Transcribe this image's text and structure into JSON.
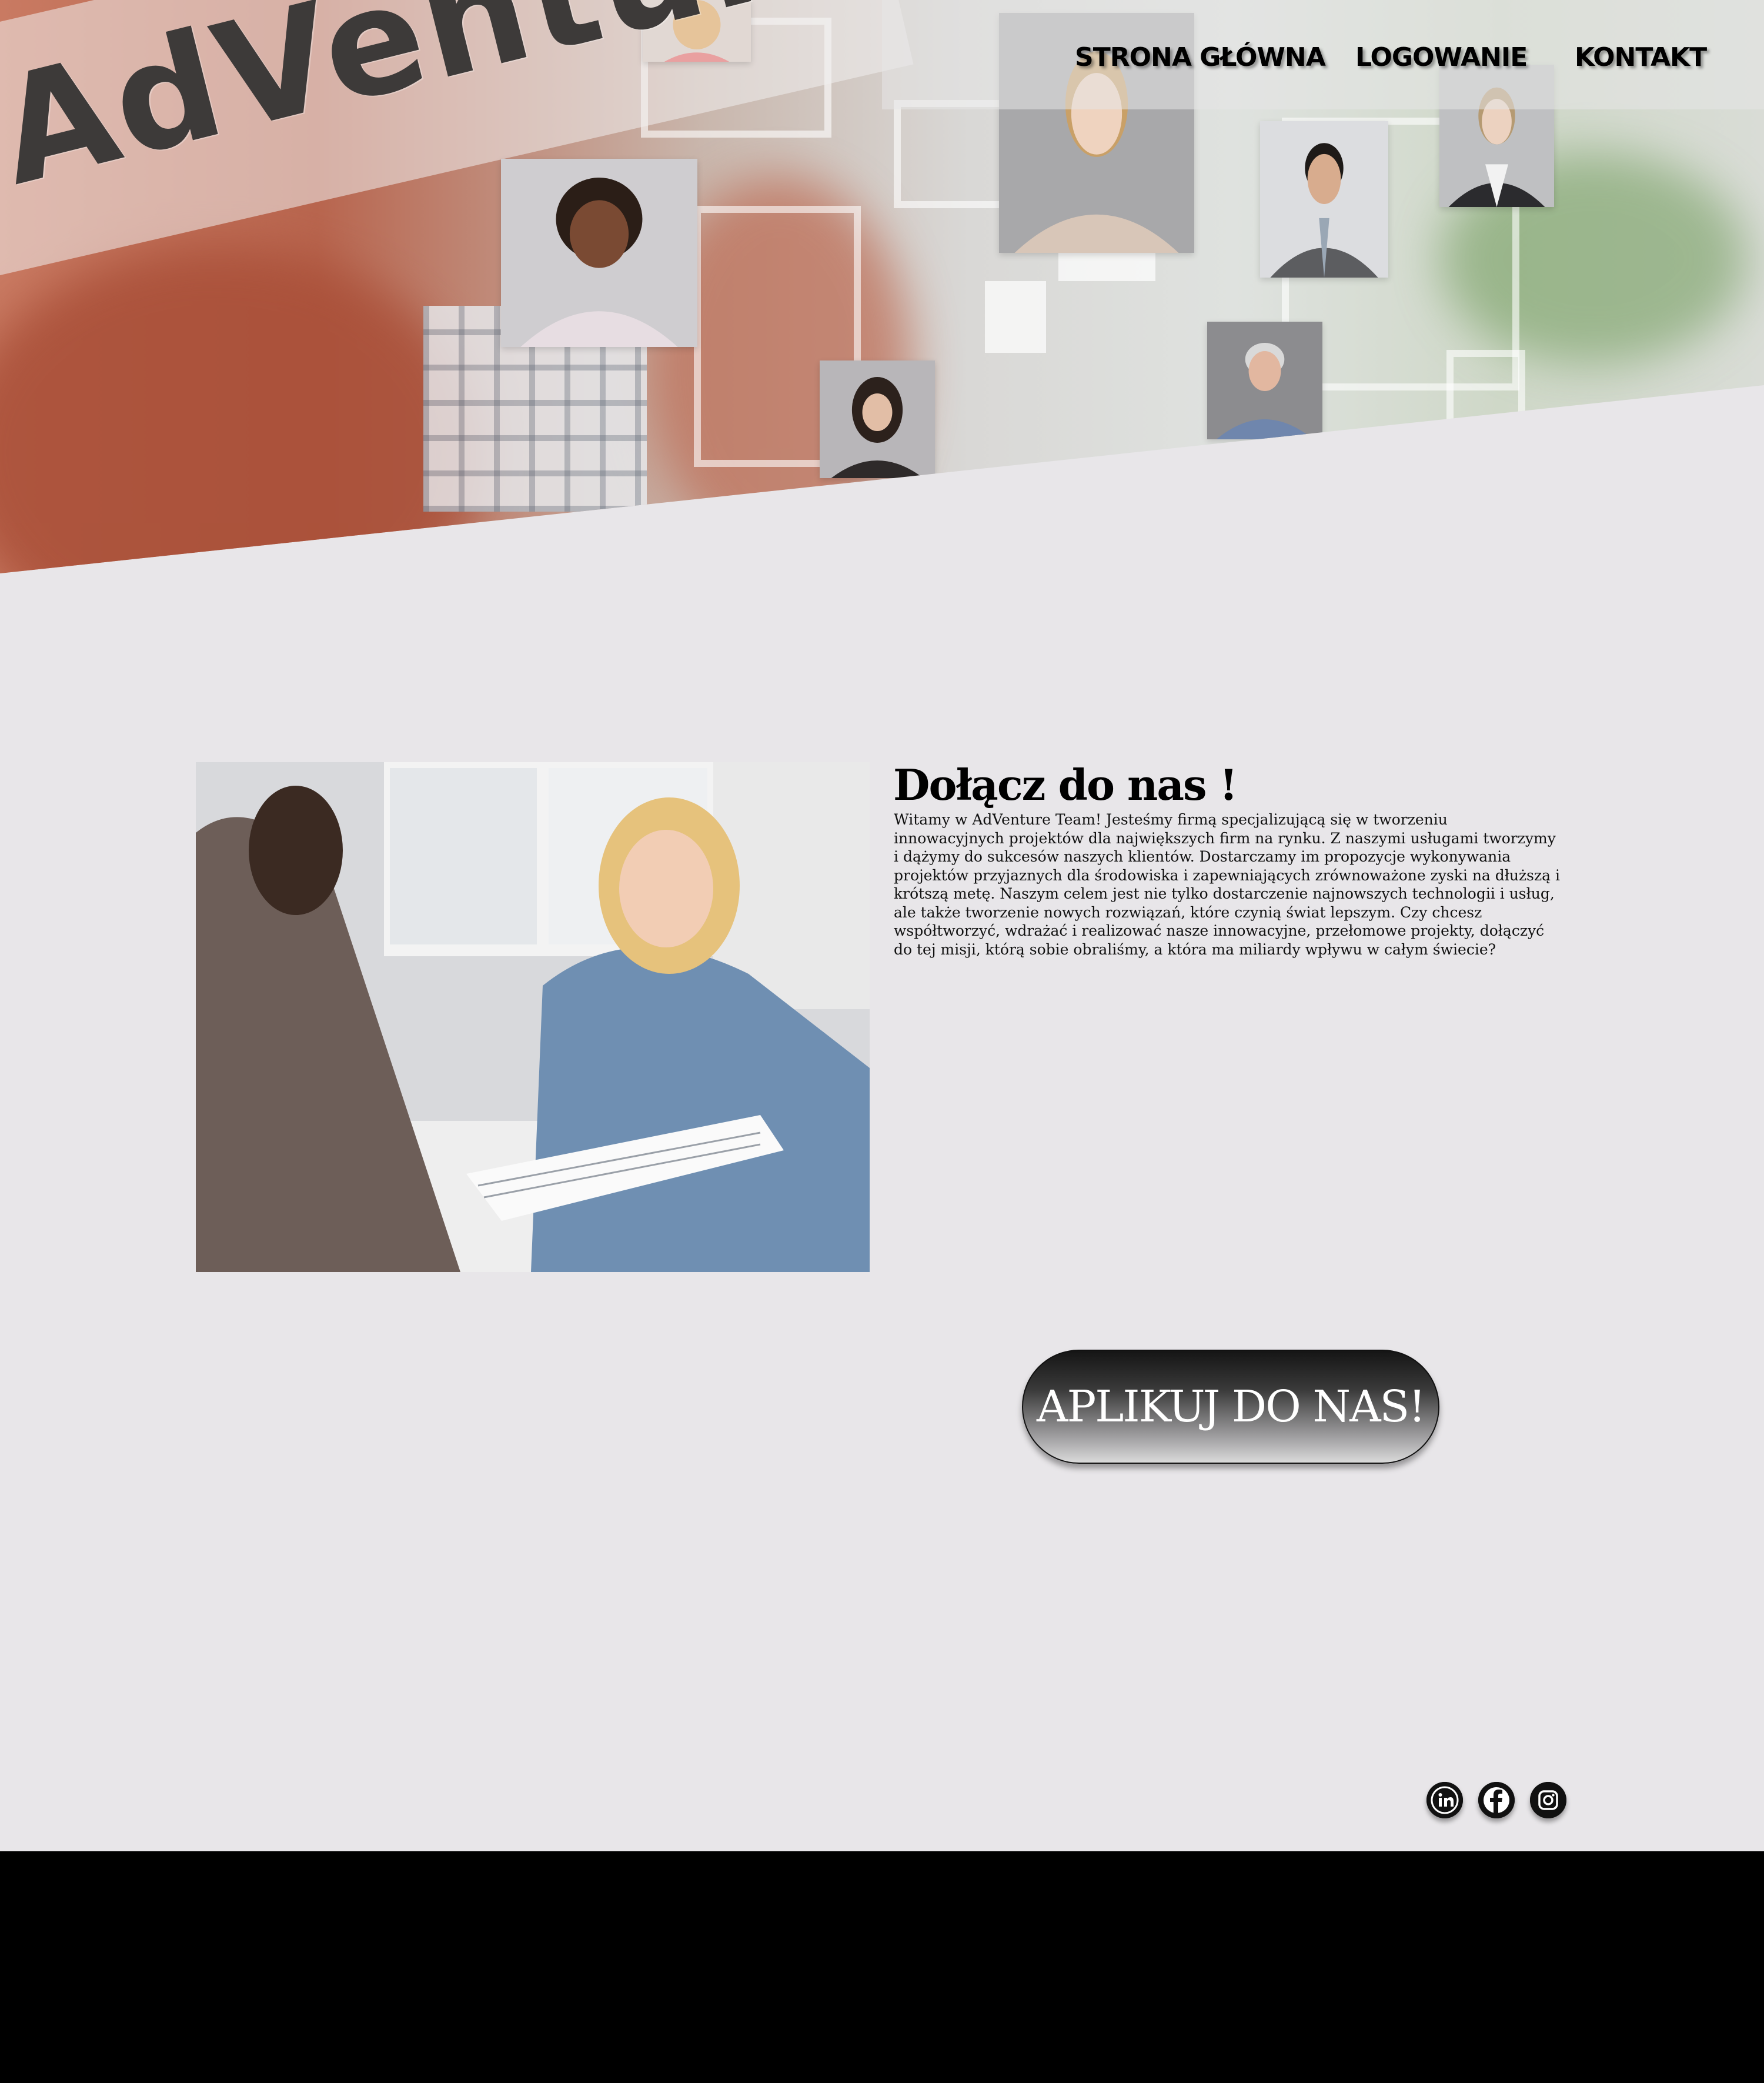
{
  "brand": {
    "logo_text": "AdVenture"
  },
  "nav": {
    "items": [
      {
        "label": "STRONA GŁÓWNA"
      },
      {
        "label": "LOGOWANIE"
      },
      {
        "label": "KONTAKT"
      }
    ]
  },
  "main": {
    "heading": "Dołącz do nas !",
    "paragraph": "Witamy w AdVenture Team! Jesteśmy firmą specjalizującą się w tworzeniu innowacyjnych projektów dla największych firm na rynku. Z naszymi usługami tworzymy i dążymy do sukcesów naszych klientów. Dostarczamy im propozycje wykonywania projektów przyjaznych dla środowiska i zapewniających zrównoważone zyski na dłuższą i krótszą metę. Naszym celem jest nie tylko dostarczenie najnowszych technologii i usług, ale także tworzenie nowych rozwiązań, które czynią świat lepszym. Czy chcesz współtworzyć, wdrażać i realizować nasze innowacyjne, przełomowe projekty, dołączyć do tej misji, którą sobie obraliśmy, a która ma miliardy wpływu w całym świecie?",
    "apply_button": "APLIKUJ DO NAS!"
  },
  "social": {
    "icons": [
      "linkedin-icon",
      "facebook-icon",
      "instagram-icon"
    ]
  },
  "colors": {
    "page_bg": "#e8e6e9",
    "footer_bg": "#000000",
    "logo_text": "#3d3a39"
  }
}
